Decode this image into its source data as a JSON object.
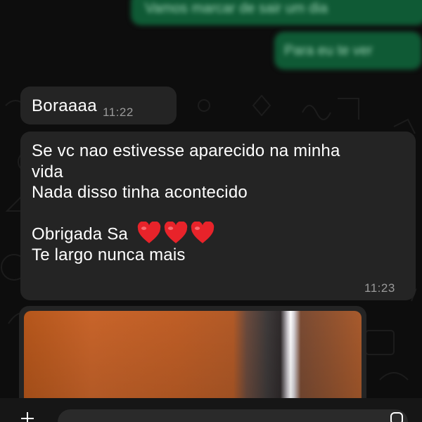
{
  "chat": {
    "outgoing": [
      {
        "text": "Vamos marcar de sair um dia"
      },
      {
        "text": "Para eu te ver"
      }
    ],
    "incoming_short": {
      "text": "Boraaaa",
      "time": "11:22"
    },
    "incoming_long": {
      "lines": [
        "Se vc nao estivesse aparecido na minha",
        "vida",
        "Nada disso tinha acontecido",
        "",
        "Obrigada Sa",
        "Te largo nunca mais"
      ],
      "hearts_count": 3,
      "time": "11:23"
    },
    "image_message": {
      "icon": "photo"
    }
  },
  "composer": {
    "input_value": "",
    "plus_icon": "plus-icon",
    "sticker_icon": "sticker-icon"
  },
  "colors": {
    "background": "#0d0d0d",
    "incoming_bubble": "#242424",
    "outgoing_bubble": "#0f5a35",
    "timestamp": "#9a9a9a",
    "heart": "#e8232a"
  }
}
